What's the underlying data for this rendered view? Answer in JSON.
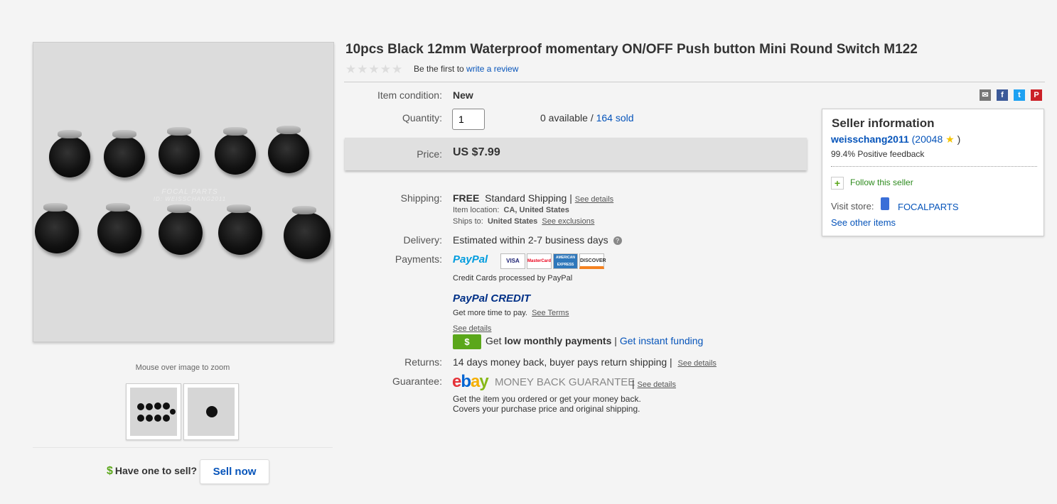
{
  "listing": {
    "title": "10pcs Black 12mm Waterproof momentary ON/OFF Push button Mini Round Switch M122",
    "review_prefix": "Be the first to",
    "review_link": "write a review",
    "condition_label": "Item condition:",
    "condition_value": "New",
    "quantity_label": "Quantity:",
    "quantity_value": "1",
    "available_text": "0 available /",
    "sold_link": "164 sold",
    "price_label": "Price:",
    "price_value": "US $7.99"
  },
  "gallery": {
    "watermark_line1": "FOCAL PARTS",
    "watermark_line2": "ID: WEISSCHANG2011",
    "zoom_hint": "Mouse over image to zoom",
    "sell_question": "Have one to sell?",
    "sell_button": "Sell now"
  },
  "shipping": {
    "label": "Shipping:",
    "free": "FREE",
    "method": "Standard Shipping |",
    "details_link": "See details",
    "location_label": "Item location:",
    "location_value": "CA, United States",
    "ships_to_label": "Ships to:",
    "ships_to_value": "United States",
    "exclusions_link": "See exclusions"
  },
  "delivery": {
    "label": "Delivery:",
    "value": "Estimated within 2-7 business days",
    "help_icon": "?"
  },
  "payments": {
    "label": "Payments:",
    "paypal": "PayPal",
    "cards": [
      "VISA",
      "MasterCard",
      "AMERICAN EXPRESS",
      "DISCOVER"
    ],
    "credit_note": "Credit Cards processed by PayPal",
    "paypal_credit": "PayPal CREDIT",
    "credit_time": "Get more time to pay.",
    "see_terms": "See Terms",
    "see_details": "See details",
    "funding_badge": "$",
    "get_text": "Get",
    "low_payments": "low monthly payments",
    "pipe": "|",
    "instant_funding": "Get instant funding"
  },
  "returns": {
    "label": "Returns:",
    "value": "14 days money back, buyer pays return shipping |",
    "details_link": "See details"
  },
  "guarantee": {
    "label": "Guarantee:",
    "ebay_e": "e",
    "ebay_b": "b",
    "ebay_a": "a",
    "ebay_y": "y",
    "mbg": "MONEY BACK GUARANTEE",
    "pipe": "|",
    "details_link": "See details",
    "line1": "Get the item you ordered or get your money back.",
    "line2": "Covers your purchase price and original shipping."
  },
  "share_icons": [
    "email-icon",
    "facebook-icon",
    "twitter-icon",
    "pinterest-icon"
  ],
  "seller": {
    "heading": "Seller information",
    "name": "weisschang2011",
    "score_open": "(20048",
    "score_close": ")",
    "feedback": "99.4% Positive feedback",
    "follow": "Follow this seller",
    "visit_label": "Visit store:",
    "store_name": "FOCALPARTS",
    "other_items": "See other items"
  },
  "colors": {
    "link": "#0654ba",
    "paypal_dark": "#003087",
    "paypal_light": "#009cde",
    "green": "#5ba71b",
    "ebay_red": "#e53238",
    "ebay_blue": "#0064d2",
    "ebay_yellow": "#f5af02",
    "ebay_green": "#86b817"
  }
}
